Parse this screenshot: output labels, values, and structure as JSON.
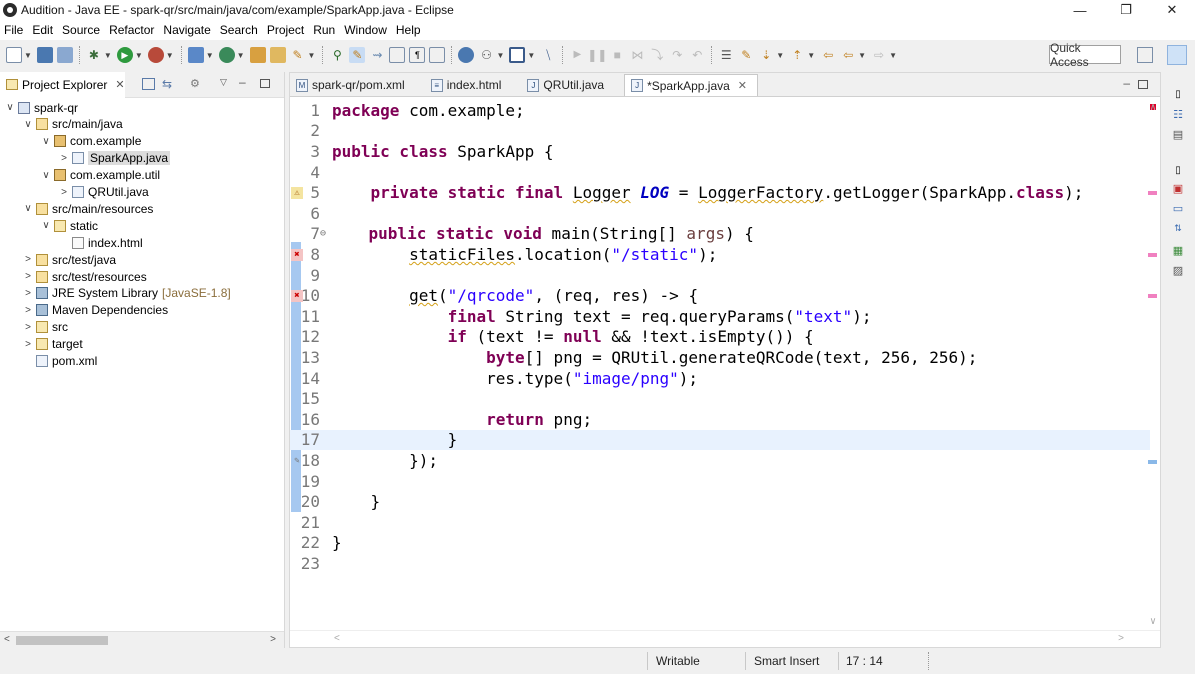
{
  "window": {
    "title": "Audition - Java EE - spark-qr/src/main/java/com/example/SparkApp.java - Eclipse",
    "minimize": "—",
    "restore": "❐",
    "close": "✕"
  },
  "menu": [
    "File",
    "Edit",
    "Source",
    "Refactor",
    "Navigate",
    "Search",
    "Project",
    "Run",
    "Window",
    "Help"
  ],
  "toolbar": {
    "quick_access": "Quick Access"
  },
  "explorer": {
    "title": "Project Explorer",
    "close": "✕",
    "tree": [
      {
        "label": "spark-qr",
        "twisty": "∨",
        "icon": "project-icon",
        "depth": 0
      },
      {
        "label": "src/main/java",
        "twisty": "∨",
        "icon": "source-folder-icon",
        "depth": 1
      },
      {
        "label": "com.example",
        "twisty": "∨",
        "icon": "package-icon",
        "depth": 2
      },
      {
        "label": "SparkApp.java",
        "twisty": ">",
        "icon": "java-file-icon",
        "depth": 3,
        "selected": true
      },
      {
        "label": "com.example.util",
        "twisty": "∨",
        "icon": "package-icon",
        "depth": 2
      },
      {
        "label": "QRUtil.java",
        "twisty": ">",
        "icon": "java-file-icon",
        "depth": 3
      },
      {
        "label": "src/main/resources",
        "twisty": "∨",
        "icon": "source-folder-icon",
        "depth": 1
      },
      {
        "label": "static",
        "twisty": "∨",
        "icon": "folder-icon",
        "depth": 2
      },
      {
        "label": "index.html",
        "twisty": "",
        "icon": "html-file-icon",
        "depth": 3
      },
      {
        "label": "src/test/java",
        "twisty": ">",
        "icon": "source-folder-icon",
        "depth": 1
      },
      {
        "label": "src/test/resources",
        "twisty": ">",
        "icon": "source-folder-icon",
        "depth": 1
      },
      {
        "label": "JRE System Library",
        "suffix": "[JavaSE-1.8]",
        "twisty": ">",
        "icon": "library-icon",
        "depth": 1
      },
      {
        "label": "Maven Dependencies",
        "twisty": ">",
        "icon": "library-icon",
        "depth": 1
      },
      {
        "label": "src",
        "twisty": ">",
        "icon": "folder-icon",
        "depth": 1
      },
      {
        "label": "target",
        "twisty": ">",
        "icon": "folder-icon",
        "depth": 1
      },
      {
        "label": "pom.xml",
        "twisty": "",
        "icon": "maven-file-icon",
        "depth": 1
      }
    ]
  },
  "editor": {
    "tabs": [
      {
        "label": "spark-qr/pom.xml",
        "icon": "M",
        "active": false
      },
      {
        "label": "index.html",
        "icon": "≡",
        "active": false
      },
      {
        "label": "QRUtil.java",
        "icon": "J",
        "active": false
      },
      {
        "label": "*SparkApp.java",
        "icon": "J",
        "active": true,
        "close": "✕"
      }
    ],
    "line_numbers": [
      "1",
      "2",
      "3",
      "4",
      "5",
      "6",
      "7",
      "8",
      "9",
      "10",
      "11",
      "12",
      "13",
      "14",
      "15",
      "16",
      "17",
      "18",
      "19",
      "20",
      "21",
      "22",
      "23"
    ],
    "fold_marker": "⊖",
    "current_line": 17,
    "code": {
      "l1_kw": "package",
      "l1_rest": " com.example;",
      "l3_kw": "public class",
      "l3_rest": " SparkApp {",
      "l5_indent": "    ",
      "l5_kw": "private static final",
      "l5_sp": " ",
      "l5_type": "Logger",
      "l5_sp2": " ",
      "l5_field": "LOG",
      "l5_eq": " = ",
      "l5_factory": "LoggerFactory",
      "l5_call": ".getLogger(SparkApp.",
      "l5_kw2": "class",
      "l5_end": ");",
      "l7_indent": "    ",
      "l7_kw": "public static void",
      "l7_rest": " main(String[] ",
      "l7_param": "args",
      "l7_end": ") {",
      "l8_indent": "        ",
      "l8_sq": "staticFiles",
      "l8_rest": ".location(",
      "l8_str": "\"/static\"",
      "l8_end": ");",
      "l10_indent": "        ",
      "l10_sq": "get",
      "l10_open": "(",
      "l10_str": "\"/qrcode\"",
      "l10_rest": ", (req, res) -> {",
      "l11_indent": "            ",
      "l11_kw": "final",
      "l11_rest": " String text = req.queryParams(",
      "l11_str": "\"text\"",
      "l11_end": ");",
      "l12_indent": "            ",
      "l12_kw": "if",
      "l12_rest": " (text != ",
      "l12_kw2": "null",
      "l12_end": " && !text.isEmpty()) {",
      "l13_indent": "                ",
      "l13_kw": "byte",
      "l13_rest": "[] png = QRUtil.generateQRCode(text, 256, 256);",
      "l14_indent": "                ",
      "l14_rest": "res.type(",
      "l14_str": "\"image/png\"",
      "l14_end": ");",
      "l16_indent": "                ",
      "l16_kw": "return",
      "l16_rest": " png;",
      "l17": "            }",
      "l18": "        });",
      "l20": "    }",
      "l22": "}"
    }
  },
  "status": {
    "writable": "Writable",
    "insert_mode": "Smart Insert",
    "position": "17 : 14"
  },
  "colors": {
    "keyword": "#7f0055",
    "string": "#2a00ff",
    "field": "#0000c0",
    "current_line": "#e8f2fe",
    "change_bar": "#a6c8f0"
  }
}
